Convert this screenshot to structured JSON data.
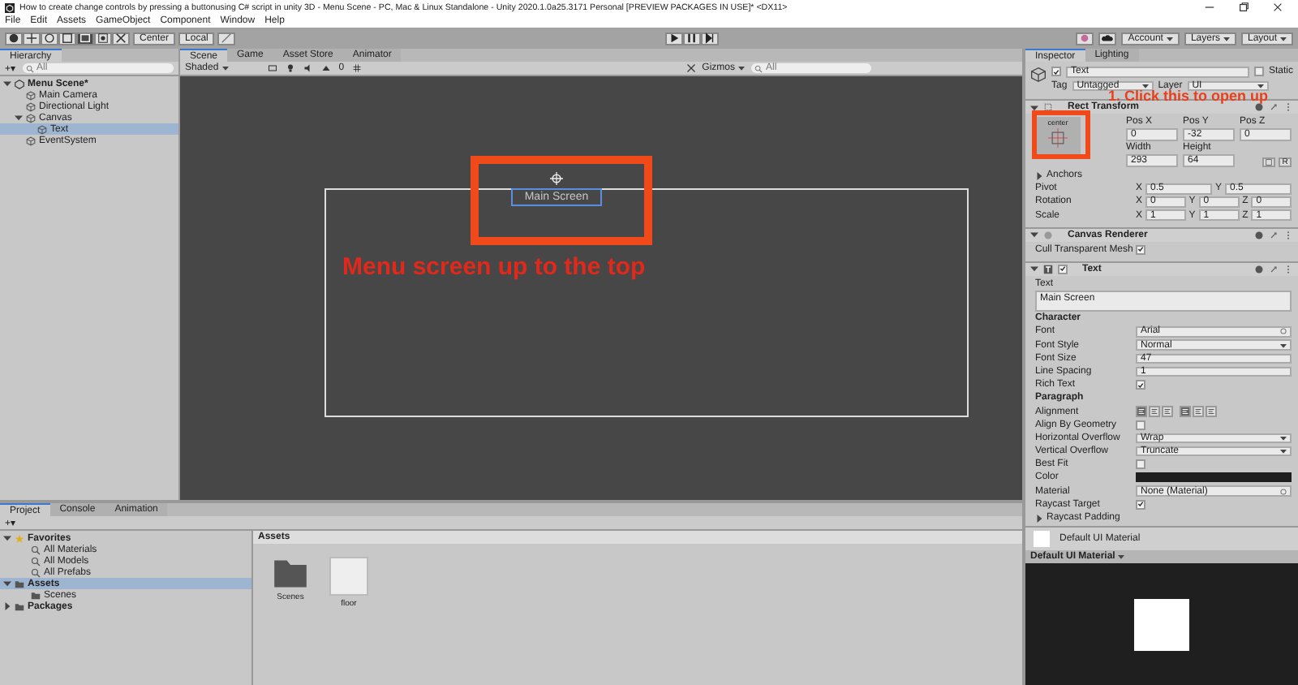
{
  "window": {
    "title": "How to create change controls by pressing a buttonusing C# script in unity 3D - Menu Scene - PC, Mac & Linux Standalone - Unity 2020.1.0a25.3171 Personal [PREVIEW PACKAGES IN USE]* <DX11>"
  },
  "menu": [
    "File",
    "Edit",
    "Assets",
    "GameObject",
    "Component",
    "Window",
    "Help"
  ],
  "toolbar": {
    "pivot": "Center",
    "space": "Local",
    "account": "Account",
    "layers": "Layers",
    "layout": "Layout"
  },
  "hierarchy": {
    "tab": "Hierarchy",
    "add_button": "+▾",
    "search": {
      "placeholder": "All"
    },
    "items": [
      {
        "label": "Menu Scene*",
        "kind": "scene",
        "expanded": true,
        "selected": false,
        "children": [
          {
            "label": "Main Camera",
            "kind": "object",
            "selected": false
          },
          {
            "label": "Directional Light",
            "kind": "object",
            "selected": false
          },
          {
            "label": "Canvas",
            "kind": "object",
            "expanded": true,
            "selected": false,
            "children": [
              {
                "label": "Text",
                "kind": "object",
                "selected": true
              }
            ]
          },
          {
            "label": "EventSystem",
            "kind": "object",
            "selected": false
          }
        ]
      }
    ]
  },
  "scene_view": {
    "tabs": [
      {
        "label": "Scene",
        "selected": true
      },
      {
        "label": "Game",
        "selected": false
      },
      {
        "label": "Asset Store",
        "selected": false
      },
      {
        "label": "Animator",
        "selected": false
      }
    ],
    "shading": "Shaded",
    "gizmo_count": "0",
    "gizmos": "Gizmos",
    "search": {
      "placeholder": "All"
    },
    "canvas_text": "Main Screen",
    "annotation": "Menu screen up to the top"
  },
  "inspector": {
    "tabs": [
      {
        "label": "Inspector",
        "selected": true
      },
      {
        "label": "Lighting",
        "selected": false
      }
    ],
    "object": {
      "name": "Text",
      "active": true,
      "static_label": "Static",
      "static": false,
      "tag_label": "Tag",
      "tag": "Untagged",
      "layer_label": "Layer",
      "layer": "UI"
    },
    "rect_transform": {
      "title": "Rect Transform",
      "anchor_preset": "center",
      "annotation": "1. Click this to open up",
      "raw_button": "R",
      "fields": [
        {
          "label": "Pos X",
          "value": "0"
        },
        {
          "label": "Pos Y",
          "value": "-32"
        },
        {
          "label": "Pos Z",
          "value": "0"
        },
        {
          "label": "Width",
          "value": "293"
        },
        {
          "label": "Height",
          "value": "64"
        }
      ],
      "rows": [
        {
          "kind": "foldout",
          "label": "Anchors",
          "expanded": false
        },
        {
          "kind": "vector",
          "label": "Pivot",
          "values": [
            {
              "axis": "X",
              "value": "0.5"
            },
            {
              "axis": "Y",
              "value": "0.5"
            }
          ]
        },
        {
          "kind": "vector",
          "label": "Rotation",
          "values": [
            {
              "axis": "X",
              "value": "0"
            },
            {
              "axis": "Y",
              "value": "0"
            },
            {
              "axis": "Z",
              "value": "0"
            }
          ]
        },
        {
          "kind": "vector",
          "label": "Scale",
          "values": [
            {
              "axis": "X",
              "value": "1"
            },
            {
              "axis": "Y",
              "value": "1"
            },
            {
              "axis": "Z",
              "value": "1"
            }
          ]
        }
      ]
    },
    "canvas_renderer": {
      "title": "Canvas Renderer",
      "rows": [
        {
          "kind": "checkbox",
          "label": "Cull Transparent Mesh",
          "checked": true
        }
      ]
    },
    "text_component": {
      "title": "Text",
      "enabled": true,
      "rows": [
        {
          "kind": "textarea",
          "label": "Text",
          "value": "Main Screen"
        },
        {
          "kind": "section",
          "label": "Character",
          "rows": [
            {
              "kind": "object",
              "label": "Font",
              "value": "Arial"
            },
            {
              "kind": "dropdown",
              "label": "Font Style",
              "value": "Normal"
            },
            {
              "kind": "input",
              "label": "Font Size",
              "value": "47"
            },
            {
              "kind": "input",
              "label": "Line Spacing",
              "value": "1"
            },
            {
              "kind": "checkbox",
              "label": "Rich Text",
              "checked": true
            }
          ]
        },
        {
          "kind": "section",
          "label": "Paragraph",
          "rows": [
            {
              "kind": "alignment",
              "label": "Alignment",
              "buttons": [
                {
                  "selected": true
                },
                {
                  "selected": false
                },
                {
                  "selected": false
                },
                {
                  "selected": true
                },
                {
                  "selected": false
                },
                {
                  "selected": false
                }
              ]
            },
            {
              "kind": "checkbox",
              "label": "Align By Geometry",
              "checked": false
            },
            {
              "kind": "dropdown",
              "label": "Horizontal Overflow",
              "value": "Wrap"
            },
            {
              "kind": "dropdown",
              "label": "Vertical Overflow",
              "value": "Truncate"
            },
            {
              "kind": "checkbox",
              "label": "Best Fit",
              "checked": false
            }
          ]
        },
        {
          "kind": "color",
          "label": "Color",
          "color": "#1e1e1e"
        },
        {
          "kind": "object",
          "label": "Material",
          "value": "None (Material)"
        },
        {
          "kind": "checkbox",
          "label": "Raycast Target",
          "checked": true
        },
        {
          "kind": "foldout",
          "label": "Raycast Padding",
          "expanded": false
        }
      ]
    },
    "material": {
      "name": "Default UI Material"
    },
    "preview": {
      "title": "Default UI Material"
    }
  },
  "project": {
    "tabs": [
      {
        "label": "Project",
        "selected": true
      },
      {
        "label": "Console",
        "selected": false
      },
      {
        "label": "Animation",
        "selected": false
      }
    ],
    "tree": [
      {
        "label": "Favorites",
        "kind": "favorites",
        "expanded": true,
        "selected": false,
        "children": [
          {
            "label": "All Materials",
            "kind": "search",
            "selected": false
          },
          {
            "label": "All Models",
            "kind": "search",
            "selected": false
          },
          {
            "label": "All Prefabs",
            "kind": "search",
            "selected": false
          }
        ]
      },
      {
        "label": "Assets",
        "kind": "folder",
        "expanded": true,
        "selected": true,
        "children": [
          {
            "label": "Scenes",
            "kind": "folder",
            "selected": false
          }
        ]
      },
      {
        "label": "Packages",
        "kind": "folder",
        "expanded": false,
        "selected": false
      }
    ],
    "add_button": "+▾",
    "breadcrumb": "Assets",
    "assets": [
      {
        "label": "Scenes",
        "kind": "folder"
      },
      {
        "label": "floor",
        "kind": "image"
      }
    ]
  }
}
